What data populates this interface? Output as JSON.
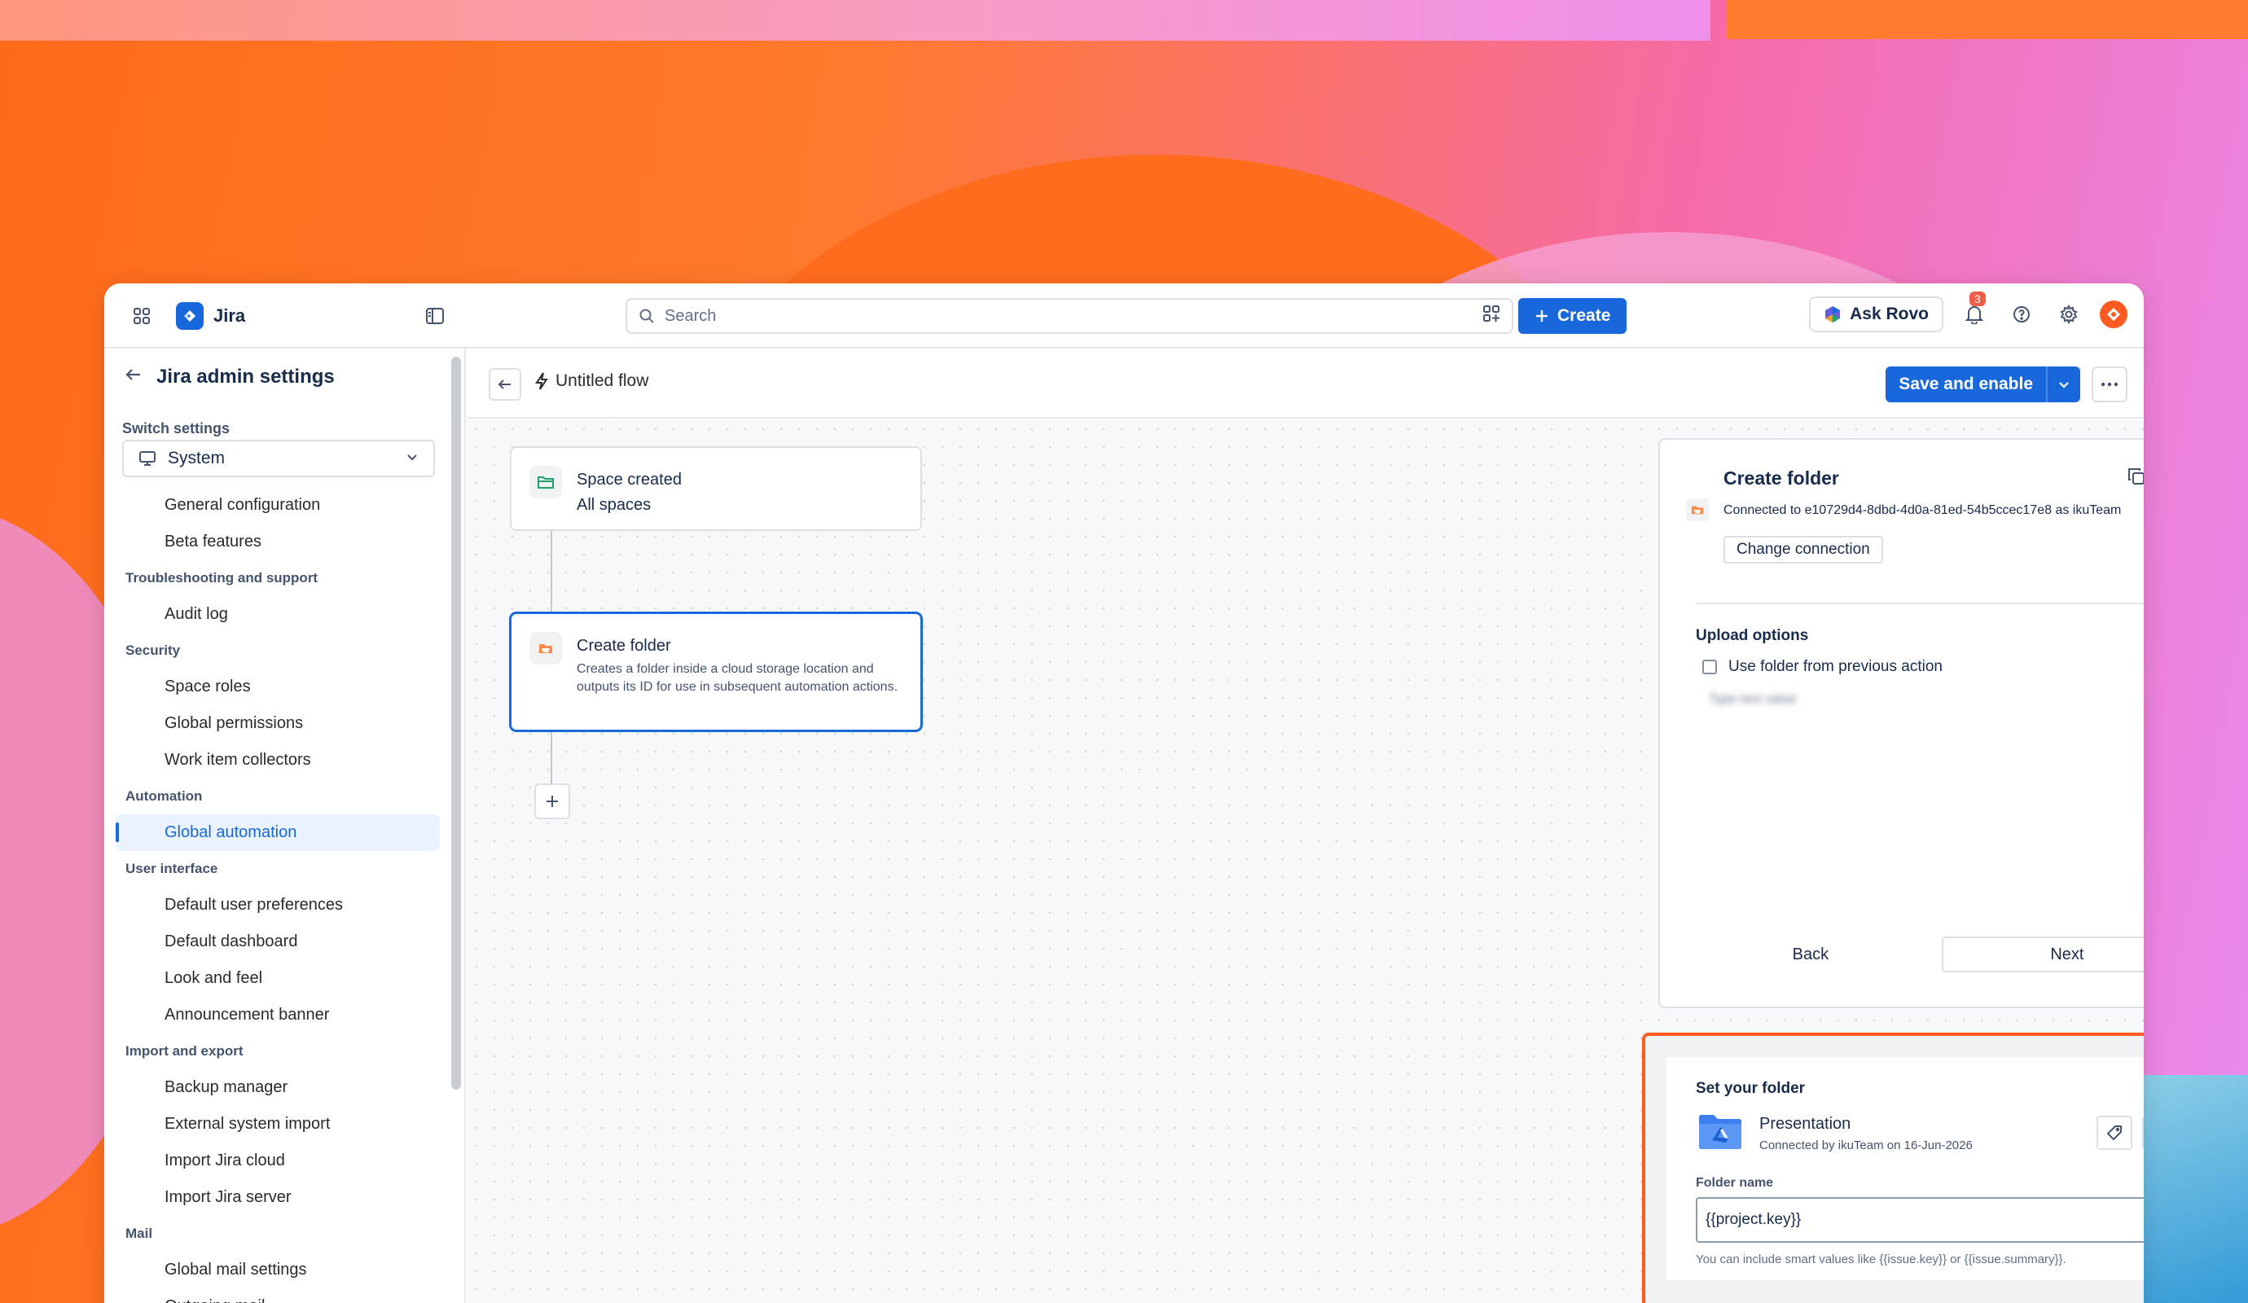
{
  "app": {
    "name": "Jira"
  },
  "topbar": {
    "search_placeholder": "Search",
    "create_label": "Create",
    "ask_rovo_label": "Ask Rovo",
    "notification_count": "3"
  },
  "sidebar": {
    "title": "Jira admin settings",
    "switch_label": "Switch settings",
    "switch_value": "System",
    "entries": [
      {
        "type": "item",
        "label": "General configuration"
      },
      {
        "type": "item",
        "label": "Beta features"
      },
      {
        "type": "section",
        "label": "Troubleshooting and support"
      },
      {
        "type": "item",
        "label": "Audit log"
      },
      {
        "type": "section",
        "label": "Security"
      },
      {
        "type": "item",
        "label": "Space roles"
      },
      {
        "type": "item",
        "label": "Global permissions"
      },
      {
        "type": "item",
        "label": "Work item collectors"
      },
      {
        "type": "section",
        "label": "Automation"
      },
      {
        "type": "item",
        "label": "Global automation",
        "active": true
      },
      {
        "type": "section",
        "label": "User interface"
      },
      {
        "type": "item",
        "label": "Default user preferences"
      },
      {
        "type": "item",
        "label": "Default dashboard"
      },
      {
        "type": "item",
        "label": "Look and feel"
      },
      {
        "type": "item",
        "label": "Announcement banner"
      },
      {
        "type": "section",
        "label": "Import and export"
      },
      {
        "type": "item",
        "label": "Backup manager"
      },
      {
        "type": "item",
        "label": "External system import"
      },
      {
        "type": "item",
        "label": "Import Jira cloud"
      },
      {
        "type": "item",
        "label": "Import Jira server"
      },
      {
        "type": "section",
        "label": "Mail"
      },
      {
        "type": "item",
        "label": "Global mail settings"
      },
      {
        "type": "item",
        "label": "Outgoing mail"
      }
    ]
  },
  "flow": {
    "title": "Untitled flow",
    "save_label": "Save and enable",
    "trigger": {
      "title": "Space created",
      "subtitle": "All spaces"
    },
    "action": {
      "title": "Create folder",
      "description": "Creates a folder inside a cloud storage location and outputs its ID for use in subsequent automation actions."
    }
  },
  "panel": {
    "title": "Create folder",
    "connection_text": "Connected to e10729d4-8dbd-4d0a-81ed-54b5ccec17e8 as ikuTeam",
    "change_connection_label": "Change connection",
    "upload_options_label": "Upload options",
    "use_previous_label": "Use folder from previous action",
    "blurred_text": "Type text value",
    "back_label": "Back",
    "next_label": "Next"
  },
  "folder_card": {
    "title": "Set your folder",
    "folder_name": "Presentation",
    "folder_connection": "Connected by ikuTeam on 16-Jun-2026",
    "field_label": "Folder name",
    "field_value": "{{project.key}}",
    "help_text": "You can include smart values like {{issue.key}} or {{issue.summary}}."
  },
  "colors": {
    "primary": "#1868db",
    "highlight_border": "#ff5a1f",
    "avatar": "#ff5a1f"
  }
}
